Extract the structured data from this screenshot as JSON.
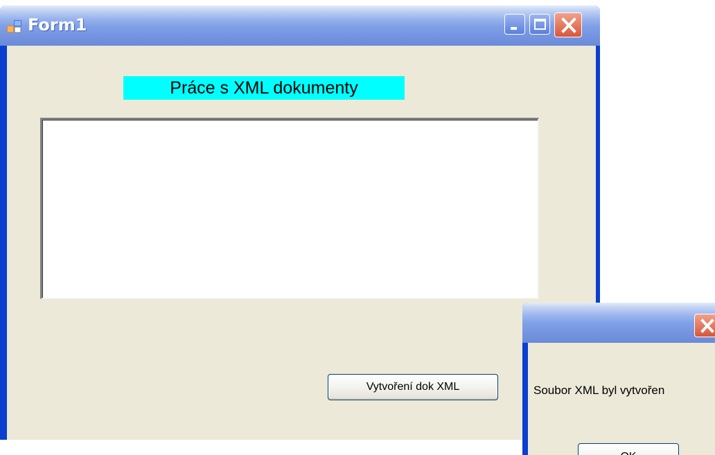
{
  "window": {
    "title": "Form1",
    "icons": {
      "app": "app-form-icon",
      "minimize": "minimize-icon",
      "maximize": "maximize-icon",
      "close": "close-icon"
    }
  },
  "form": {
    "heading": "Práce s XML dokumenty",
    "heading_bg": "#00ffff",
    "textarea_value": "",
    "create_button": "Vytvoření dok XML"
  },
  "dialog": {
    "message": "Soubor XML byl vytvořen",
    "ok_button": "OK",
    "icons": {
      "close": "close-icon"
    }
  },
  "colors": {
    "titlebar_blue": "#0a3fd0",
    "client_bg": "#ece9d8",
    "close_red": "#d8563a"
  }
}
